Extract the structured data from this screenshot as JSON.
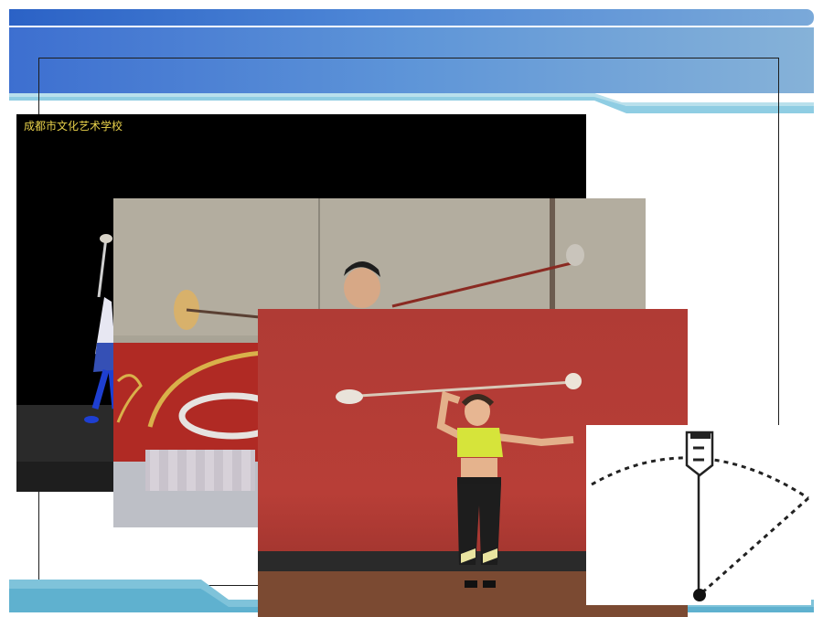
{
  "slide": {
    "accent_colors": [
      "#2b62c6",
      "#5e95d8",
      "#86c7dc"
    ]
  },
  "photos": {
    "stage": {
      "caption": "成都市文化艺术学校",
      "icon": "performer-photo"
    },
    "rehearsal": {
      "icon": "rehearsal-photo"
    },
    "red_stage": {
      "icon": "red-stage-photo"
    }
  },
  "diagram": {
    "icon": "swing-arc-diagram"
  }
}
